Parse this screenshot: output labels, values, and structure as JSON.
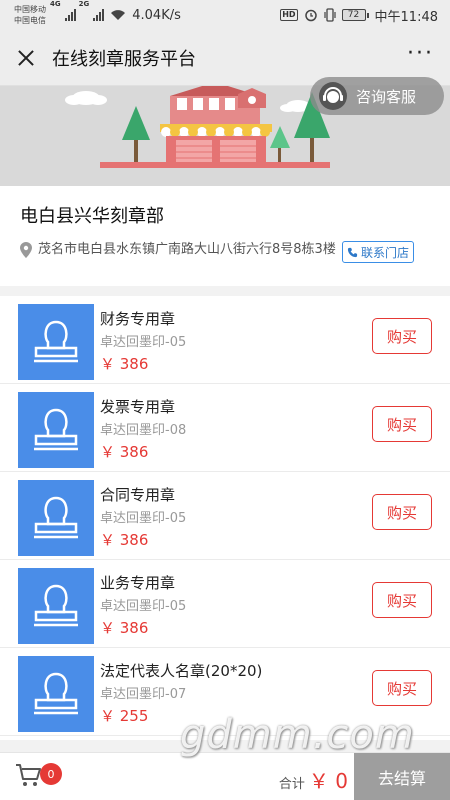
{
  "status_bar": {
    "carrier_1": "中国移动",
    "carrier_2": "中国电信",
    "net_1": "4G",
    "net_2": "2G",
    "speed": "4.04K/s",
    "hd": "HD",
    "battery": "72",
    "time": "中午11:48"
  },
  "header": {
    "title": "在线刻章服务平台",
    "more": "···"
  },
  "banner": {
    "consult_label": "咨询客服"
  },
  "shop": {
    "name": "电白县兴华刻章部",
    "address": "茂名市电白县水东镇广南路大山八街六行8号8栋3楼",
    "contact_label": "联系门店"
  },
  "products": [
    {
      "name": "财务专用章",
      "model": "卓达回墨印-05",
      "price": "￥ 386",
      "buy_label": "购买"
    },
    {
      "name": "发票专用章",
      "model": "卓达回墨印-08",
      "price": "￥ 386",
      "buy_label": "购买"
    },
    {
      "name": "合同专用章",
      "model": "卓达回墨印-05",
      "price": "￥ 386",
      "buy_label": "购买"
    },
    {
      "name": "业务专用章",
      "model": "卓达回墨印-05",
      "price": "￥ 386",
      "buy_label": "购买"
    },
    {
      "name": "法定代表人名章(20*20)",
      "model": "卓达回墨印-07",
      "price": "￥ 255",
      "buy_label": "购买"
    }
  ],
  "cart": {
    "count": "0",
    "total_label": "合计",
    "total_value": "￥ 0",
    "checkout_label": "去结算"
  },
  "watermark": "gdmm.com",
  "colors": {
    "accent_red": "#e53935",
    "thumb_blue": "#4a8de8",
    "link_blue": "#2d78c8",
    "checkout_gray": "#9e9e9e"
  },
  "icons": [
    "close-icon",
    "more-icon",
    "headset-icon",
    "location-pin-icon",
    "phone-icon",
    "stamp-icon",
    "cart-icon"
  ]
}
